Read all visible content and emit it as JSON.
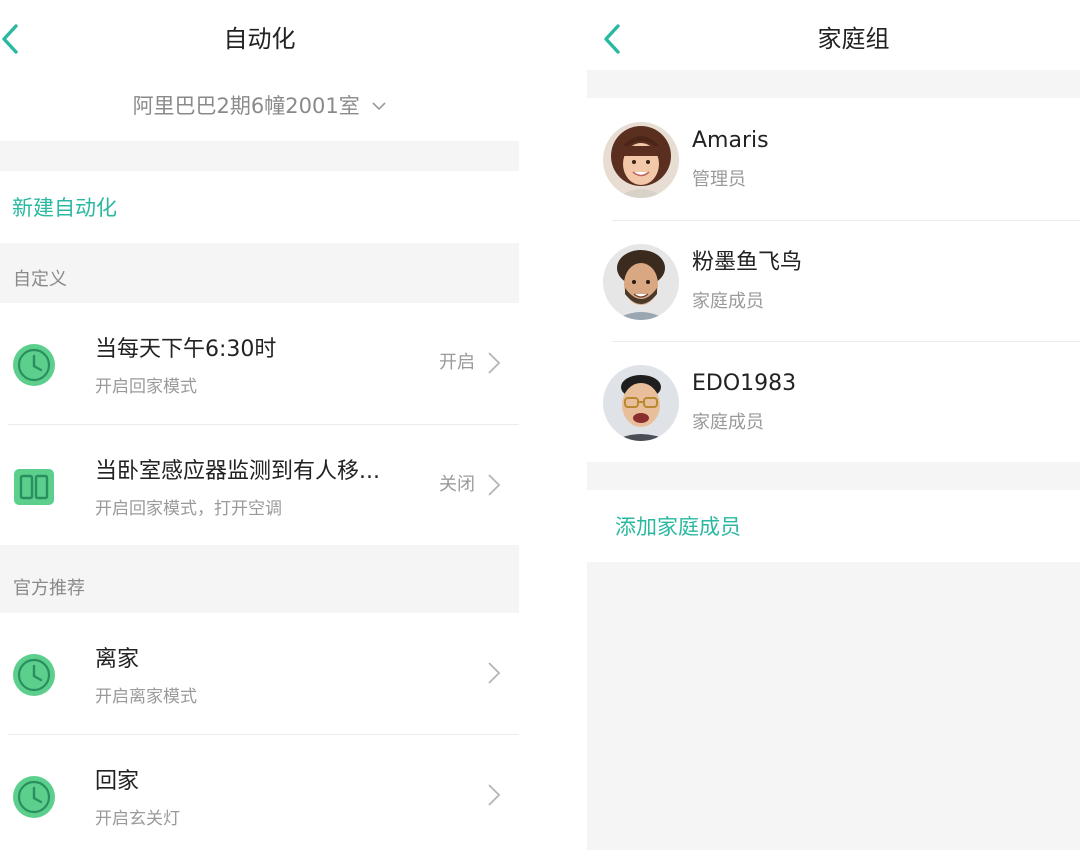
{
  "automation": {
    "title": "自动化",
    "home_name": "阿里巴巴2期6幢2001室",
    "new_automation": "新建自动化",
    "sections": {
      "custom": "自定义",
      "official": "官方推荐"
    },
    "custom_items": [
      {
        "title": "当每天下午6:30时",
        "subtitle": "开启回家模式",
        "state": "开启",
        "icon": "clock-icon"
      },
      {
        "title": "当卧室感应器监测到有人移...",
        "subtitle": "开启回家模式，打开空调",
        "state": "关闭",
        "icon": "sensor-icon"
      }
    ],
    "official_items": [
      {
        "title": "离家",
        "subtitle": "开启离家模式",
        "icon": "clock-icon"
      },
      {
        "title": "回家",
        "subtitle": "开启玄关灯",
        "icon": "clock-icon"
      }
    ]
  },
  "family": {
    "title": "家庭组",
    "members": [
      {
        "name": "Amaris",
        "role": "管理员",
        "avatar": "avatar-woman"
      },
      {
        "name": "粉墨鱼飞鸟",
        "role": "家庭成员",
        "avatar": "avatar-bearded-man"
      },
      {
        "name": "EDO1983",
        "role": "家庭成员",
        "avatar": "avatar-glasses-man"
      }
    ],
    "add_member": "添加家庭成员"
  },
  "colors": {
    "accent": "#2ab9a0",
    "icon_green": "#5ccf8d",
    "background_gray": "#f5f5f5",
    "secondary_text": "#9a9a9a"
  }
}
